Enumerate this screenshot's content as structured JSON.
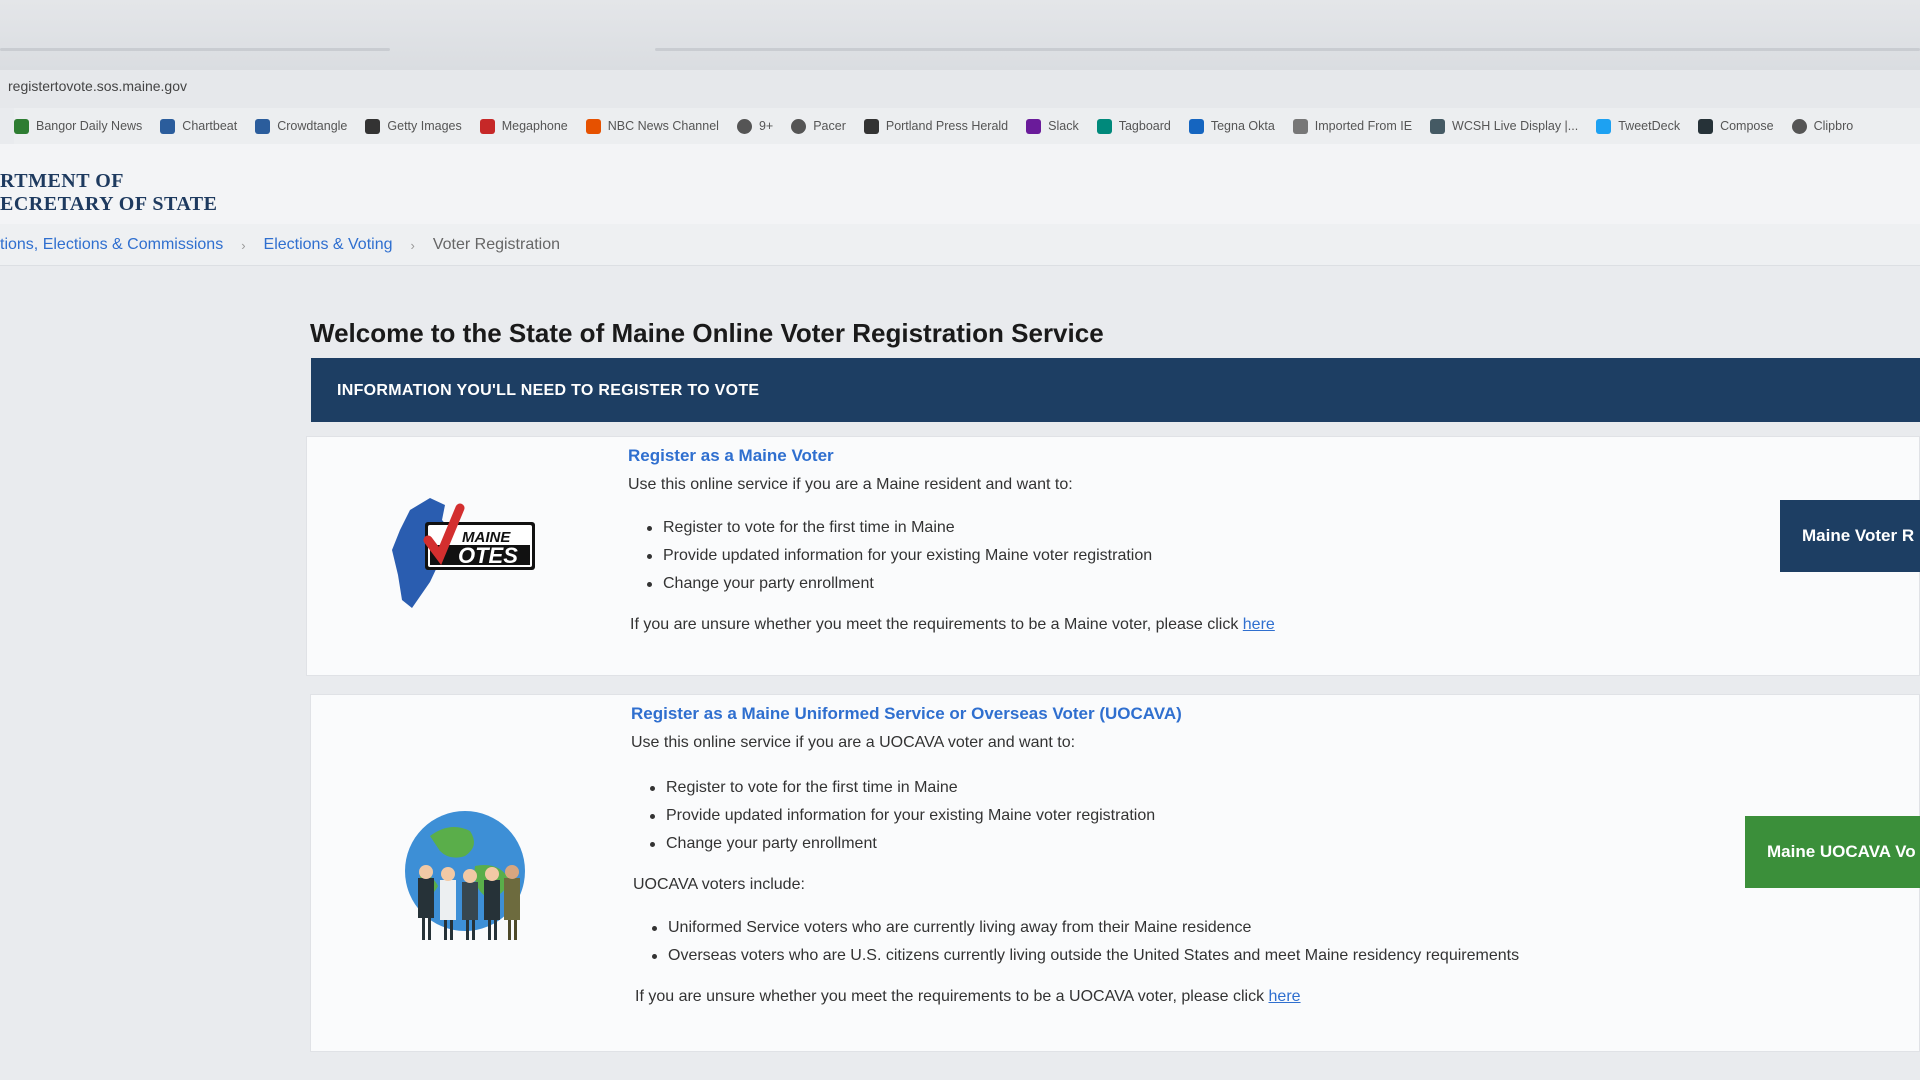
{
  "browser": {
    "url": "registertovote.sos.maine.gov",
    "bookmarks": [
      {
        "label": "Bangor Daily News",
        "icon": "bdn-icon",
        "color": "#2e7d32"
      },
      {
        "label": "Chartbeat",
        "icon": "chartbeat-icon",
        "color": "#2b5d9c"
      },
      {
        "label": "Crowdtangle",
        "icon": "crowdtangle-icon",
        "color": "#2b5d9c"
      },
      {
        "label": "Getty Images",
        "icon": "getty-icon",
        "color": "#333333"
      },
      {
        "label": "Megaphone",
        "icon": "megaphone-icon",
        "color": "#c62828"
      },
      {
        "label": "NBC News Channel",
        "icon": "nbc-peacock-icon",
        "color": "#e65100"
      },
      {
        "label": "9+",
        "icon": "globe-icon",
        "color": "#555555"
      },
      {
        "label": "Pacer",
        "icon": "globe-icon",
        "color": "#555555"
      },
      {
        "label": "Portland Press Herald",
        "icon": "pph-icon",
        "color": "#333333"
      },
      {
        "label": "Slack",
        "icon": "slack-icon",
        "color": "#6a1b9a"
      },
      {
        "label": "Tagboard",
        "icon": "tagboard-icon",
        "color": "#00897b"
      },
      {
        "label": "Tegna Okta",
        "icon": "okta-icon",
        "color": "#1565c0"
      },
      {
        "label": "Imported From IE",
        "icon": "folder-icon",
        "color": "#777777"
      },
      {
        "label": "WCSH Live Display |...",
        "icon": "wcsh-icon",
        "color": "#455a64"
      },
      {
        "label": "TweetDeck",
        "icon": "tweetdeck-icon",
        "color": "#1da1f2"
      },
      {
        "label": "Compose",
        "icon": "compose-icon",
        "color": "#263238"
      },
      {
        "label": "Clipbro",
        "icon": "globe-icon",
        "color": "#555555"
      }
    ]
  },
  "header": {
    "agency_line1": "RTMENT OF",
    "agency_line2": "ECRETARY OF STATE"
  },
  "breadcrumb": {
    "item1": "tions, Elections & Commissions",
    "item2": "Elections & Voting",
    "current": "Voter Registration"
  },
  "main": {
    "title": "Welcome to the State of Maine Online Voter Registration Service",
    "banner": "INFORMATION YOU'LL NEED TO REGISTER TO VOTE",
    "maine_voter": {
      "title": "Register as a Maine Voter",
      "intro": "Use this online service if you are a Maine resident and want to:",
      "items": [
        "Register to vote for the first time in Maine",
        "Provide updated information for your existing Maine voter registration",
        "Change your party enrollment"
      ],
      "unsure_text": "If you are unsure whether you meet the requirements to be a Maine voter, please click",
      "link": "here",
      "button": "Maine Voter R",
      "logo_text_top": "MAINE",
      "logo_text_bottom": "OTES"
    },
    "uocava_voter": {
      "title": "Register as a Maine Uniformed Service or Overseas Voter (UOCAVA)",
      "intro": "Use this online service if you are a UOCAVA voter and want to:",
      "items": [
        "Register to vote for the first time in Maine",
        "Provide updated information for your existing Maine voter registration",
        "Change your party enrollment"
      ],
      "include_heading": "UOCAVA voters include:",
      "include_items": [
        "Uniformed Service voters who are currently living away from their Maine residence",
        "Overseas voters who are U.S. citizens currently living outside the United States and meet Maine residency requirements"
      ],
      "unsure_text": "If you are unsure whether you meet the requirements to be a UOCAVA voter, please click",
      "link": "here",
      "button": "Maine UOCAVA Vo"
    }
  },
  "colors": {
    "navy": "#1d3e63",
    "green": "#3b8f3a",
    "link": "#2f6fcf"
  }
}
